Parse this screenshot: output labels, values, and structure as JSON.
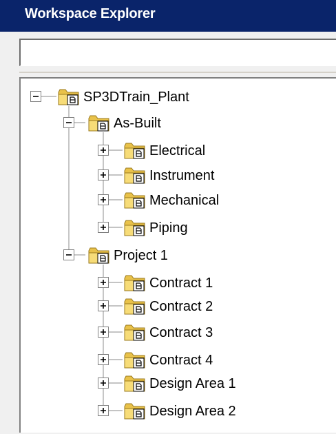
{
  "window": {
    "title": "Workspace Explorer"
  },
  "search": {
    "value": ""
  },
  "tree": {
    "root": {
      "label": "SP3DTrain_Plant",
      "expanded": true,
      "icon": "folder-document-icon"
    },
    "as_built": {
      "label": "As-Built",
      "expanded": true,
      "children": [
        {
          "label": "Electrical",
          "expanded": false
        },
        {
          "label": "Instrument",
          "expanded": false
        },
        {
          "label": "Mechanical",
          "expanded": false
        },
        {
          "label": "Piping",
          "expanded": false
        }
      ]
    },
    "project1": {
      "label": "Project 1",
      "expanded": true,
      "children": [
        {
          "label": "Contract 1",
          "expanded": false
        },
        {
          "label": "Contract 2",
          "expanded": false
        },
        {
          "label": "Contract 3",
          "expanded": false
        },
        {
          "label": "Contract 4",
          "expanded": false
        },
        {
          "label": "Design Area 1",
          "expanded": false
        },
        {
          "label": "Design Area 2",
          "expanded": false
        }
      ]
    }
  },
  "colors": {
    "titlebar": "#0a246a",
    "folder_fill": "#f5d96b",
    "folder_dark": "#b8912a"
  }
}
